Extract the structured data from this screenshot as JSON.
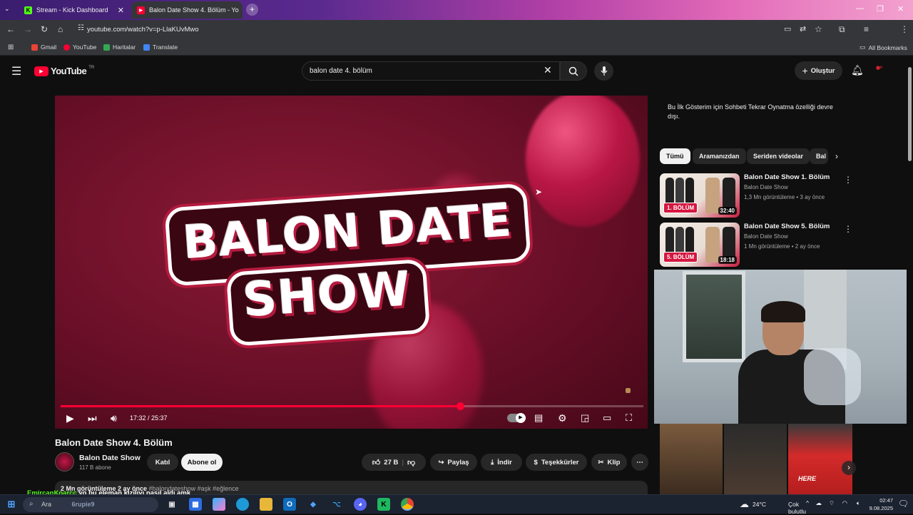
{
  "browser": {
    "tabs": [
      {
        "title": "Stream - Kick Dashboard",
        "favicon": "kick-icon"
      },
      {
        "title": "Balon Date Show 4. Bölüm - Yo",
        "favicon": "youtube-icon"
      }
    ],
    "url": "youtube.com/watch?v=p-LlaKUvMwo",
    "bookmarks": [
      "Gmail",
      "YouTube",
      "Haritalar",
      "Translate"
    ],
    "all_bookmarks": "All Bookmarks"
  },
  "youtube": {
    "logo": "YouTube",
    "region": "TR",
    "search_value": "balon date 4. bölüm",
    "create_label": "Oluştur"
  },
  "player": {
    "logo_line1": "BALON DATE",
    "logo_line2": "SHOW",
    "time": "17:32 / 25:37",
    "progress_fraction": 0.685
  },
  "video": {
    "title": "Balon Date Show 4. Bölüm",
    "channel": "Balon Date Show",
    "subscribers": "117 B abone",
    "join_label": "Katıl",
    "subscribe_label": "Abone ol",
    "likes": "27 B",
    "share_label": "Paylaş",
    "download_label": "İndir",
    "thanks_label": "Teşekkürler",
    "clip_label": "Klip",
    "stats": "2 Mn görüntüleme  2 ay önce",
    "tags": "#balondateshow #aşk #eğlence"
  },
  "sidebar": {
    "chat_note": "Bu İlk Gösterim için Sohbeti Tekrar Oynatma özelliği devre dışı.",
    "chips": [
      "Tümü",
      "Aramanızdan",
      "Seriden videolar",
      "Bal"
    ],
    "recommendations": [
      {
        "title": "Balon Date Show 1. Bölüm",
        "channel": "Balon Date Show",
        "meta": "1,3 Mn görüntüleme • 3 ay önce",
        "badge": "1. BÖLÜM",
        "duration": "32:40"
      },
      {
        "title": "Balon Date Show 5. Bölüm",
        "channel": "Balon Date Show",
        "meta": "1 Mn görüntüleme • 2 ay önce",
        "badge": "5. BÖLÜM",
        "duration": "18:18"
      }
    ],
    "shorts_caption": "HERE"
  },
  "overlay": {
    "chat_user": "EmircanKoarcc",
    "chat_message": "yo bu eleman kızılıyı nasıl aldı amk"
  },
  "taskbar": {
    "search_placeholder": "Ara",
    "search_suggestion": "6rupie9",
    "weather_temp": "24°C",
    "weather_text": "Çok bulutlu",
    "time": "02:47",
    "date": "9.08.2025"
  },
  "colors": {
    "yt_red": "#ff0033",
    "bg": "#0f0f0f",
    "kick_green": "#53fc18",
    "badge_red": "#d5163f"
  }
}
